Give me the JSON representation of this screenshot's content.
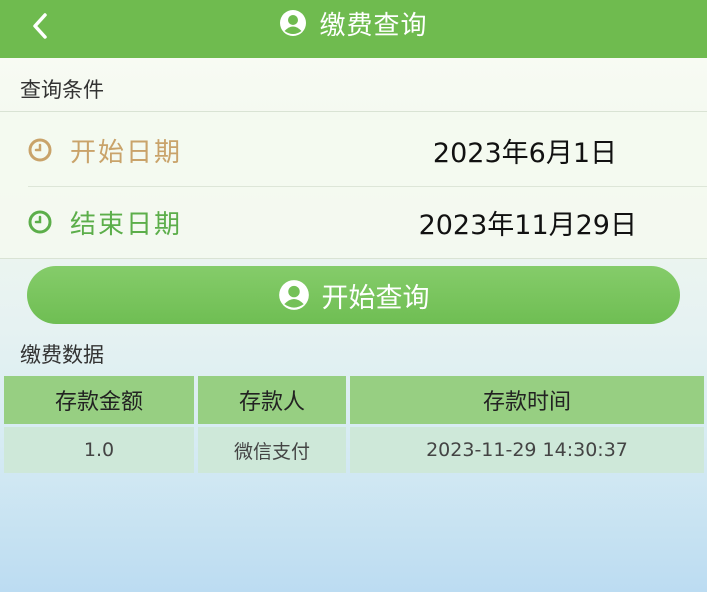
{
  "header": {
    "title": "缴费查询",
    "back_icon": "chevron-left-icon",
    "title_icon": "user-circle-icon"
  },
  "query": {
    "section_label": "查询条件",
    "start": {
      "label": "开始日期",
      "value": "2023年6月1日",
      "icon": "clock-icon",
      "color": "#c9a36a"
    },
    "end": {
      "label": "结束日期",
      "value": "2023年11月29日",
      "icon": "clock-icon",
      "color": "#5cae4a"
    },
    "button_label": "开始查询"
  },
  "results": {
    "section_label": "缴费数据",
    "columns": [
      "存款金额",
      "存款人",
      "存款时间"
    ],
    "rows": [
      [
        "1.0",
        "微信支付",
        "2023-11-29 14:30:37"
      ]
    ]
  },
  "colors": {
    "accent": "#6fbb4f",
    "table_header": "#97cf82",
    "table_cell": "#cde8d6"
  }
}
